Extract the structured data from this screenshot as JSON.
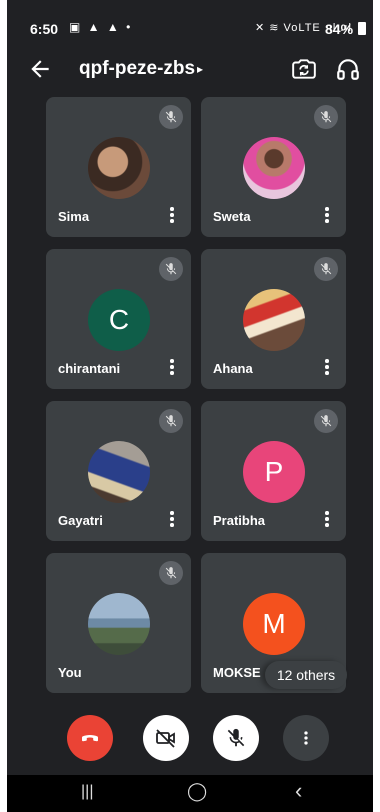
{
  "status_bar": {
    "time": "6:50",
    "left_icons": "▣ ▲ ▲ •",
    "right_icons": "✕ ≋ VoLTE .ıl .ıl",
    "battery": "84%"
  },
  "header": {
    "title": "qpf-peze-zbs",
    "caret": "▸"
  },
  "participants": [
    {
      "name": "Sima",
      "avatar_type": "photo",
      "avatar_color": "#6b4a3a"
    },
    {
      "name": "Sweta",
      "avatar_type": "photo",
      "avatar_color": "#d7a7c7"
    },
    {
      "name": "chirantani",
      "avatar_type": "letter",
      "letter": "C",
      "avatar_color": "#0f5e49"
    },
    {
      "name": "Ahana",
      "avatar_type": "photo",
      "avatar_color": "#b58d5f"
    },
    {
      "name": "Gayatri",
      "avatar_type": "photo",
      "avatar_color": "#6d5a4b"
    },
    {
      "name": "Pratibha",
      "avatar_type": "letter",
      "letter": "P",
      "avatar_color": "#e8457a"
    },
    {
      "name": "You",
      "avatar_type": "photo",
      "avatar_color": "#7f9bb5"
    },
    {
      "name": "MOKSE",
      "avatar_type": "letter",
      "letter": "M",
      "avatar_color": "#f4511e"
    }
  ],
  "others_label": "12 others",
  "controls": {
    "end_call_color": "#ea4335",
    "camera_state": "off",
    "mic_state": "muted"
  },
  "nav": {
    "recents": "|||",
    "home": "◯",
    "back": "‹"
  }
}
